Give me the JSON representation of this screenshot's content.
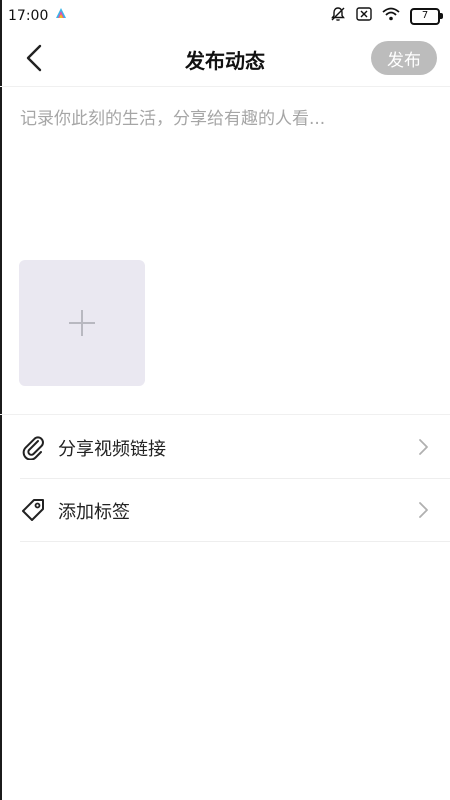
{
  "status_bar": {
    "time": "17:00",
    "battery": "7",
    "icons": [
      "app-logo-icon",
      "mute-bell-icon",
      "sim-x-icon",
      "wifi-icon",
      "battery-icon"
    ]
  },
  "nav": {
    "title": "发布动态",
    "publish_label": "发布"
  },
  "composer": {
    "placeholder": "记录你此刻的生活，分享给有趣的人看..."
  },
  "options": [
    {
      "label": "分享视频链接",
      "icon": "paperclip-icon"
    },
    {
      "label": "添加标签",
      "icon": "tag-icon"
    }
  ],
  "colors": {
    "publish_disabled": "#bcbcbc",
    "image_slot_bg": "#eae8f1",
    "placeholder_text": "#a6a6a6"
  }
}
